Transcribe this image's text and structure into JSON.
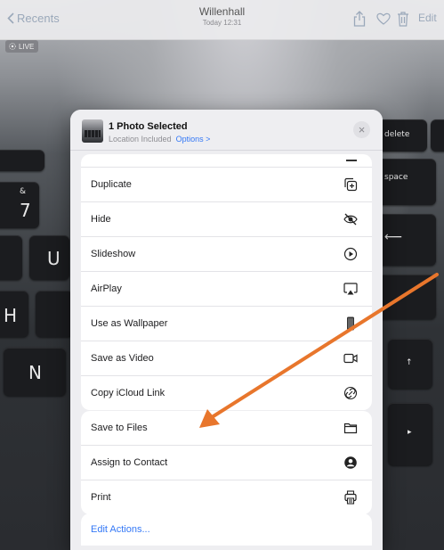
{
  "nav": {
    "back_label": "Recents",
    "title": "Willenhall",
    "subtitle": "Today 12:31",
    "edit_label": "Edit"
  },
  "photo": {
    "live_label": "LIVE",
    "keys": [
      "7",
      "U",
      "H",
      "N",
      "delete",
      "space"
    ]
  },
  "sheet": {
    "header": {
      "title": "1 Photo Selected",
      "subtitle": "Location Included",
      "options_label": "Options >",
      "close_symbol": "×"
    },
    "group1": [
      {
        "label": "Duplicate",
        "icon": "duplicate-icon"
      },
      {
        "label": "Hide",
        "icon": "hide-eye-icon"
      },
      {
        "label": "Slideshow",
        "icon": "play-circle-icon"
      },
      {
        "label": "AirPlay",
        "icon": "airplay-icon"
      },
      {
        "label": "Use as Wallpaper",
        "icon": "phone-icon"
      },
      {
        "label": "Save as Video",
        "icon": "video-icon"
      },
      {
        "label": "Copy iCloud Link",
        "icon": "link-icon"
      }
    ],
    "group2": [
      {
        "label": "Save to Files",
        "icon": "folder-icon"
      },
      {
        "label": "Assign to Contact",
        "icon": "contact-icon"
      },
      {
        "label": "Print",
        "icon": "printer-icon"
      }
    ],
    "edit_actions_label": "Edit Actions..."
  },
  "annotation": {
    "arrow_color": "#e8762c"
  },
  "colors": {
    "accent": "#3478f6",
    "sheet_bg": "#eeeef1"
  }
}
